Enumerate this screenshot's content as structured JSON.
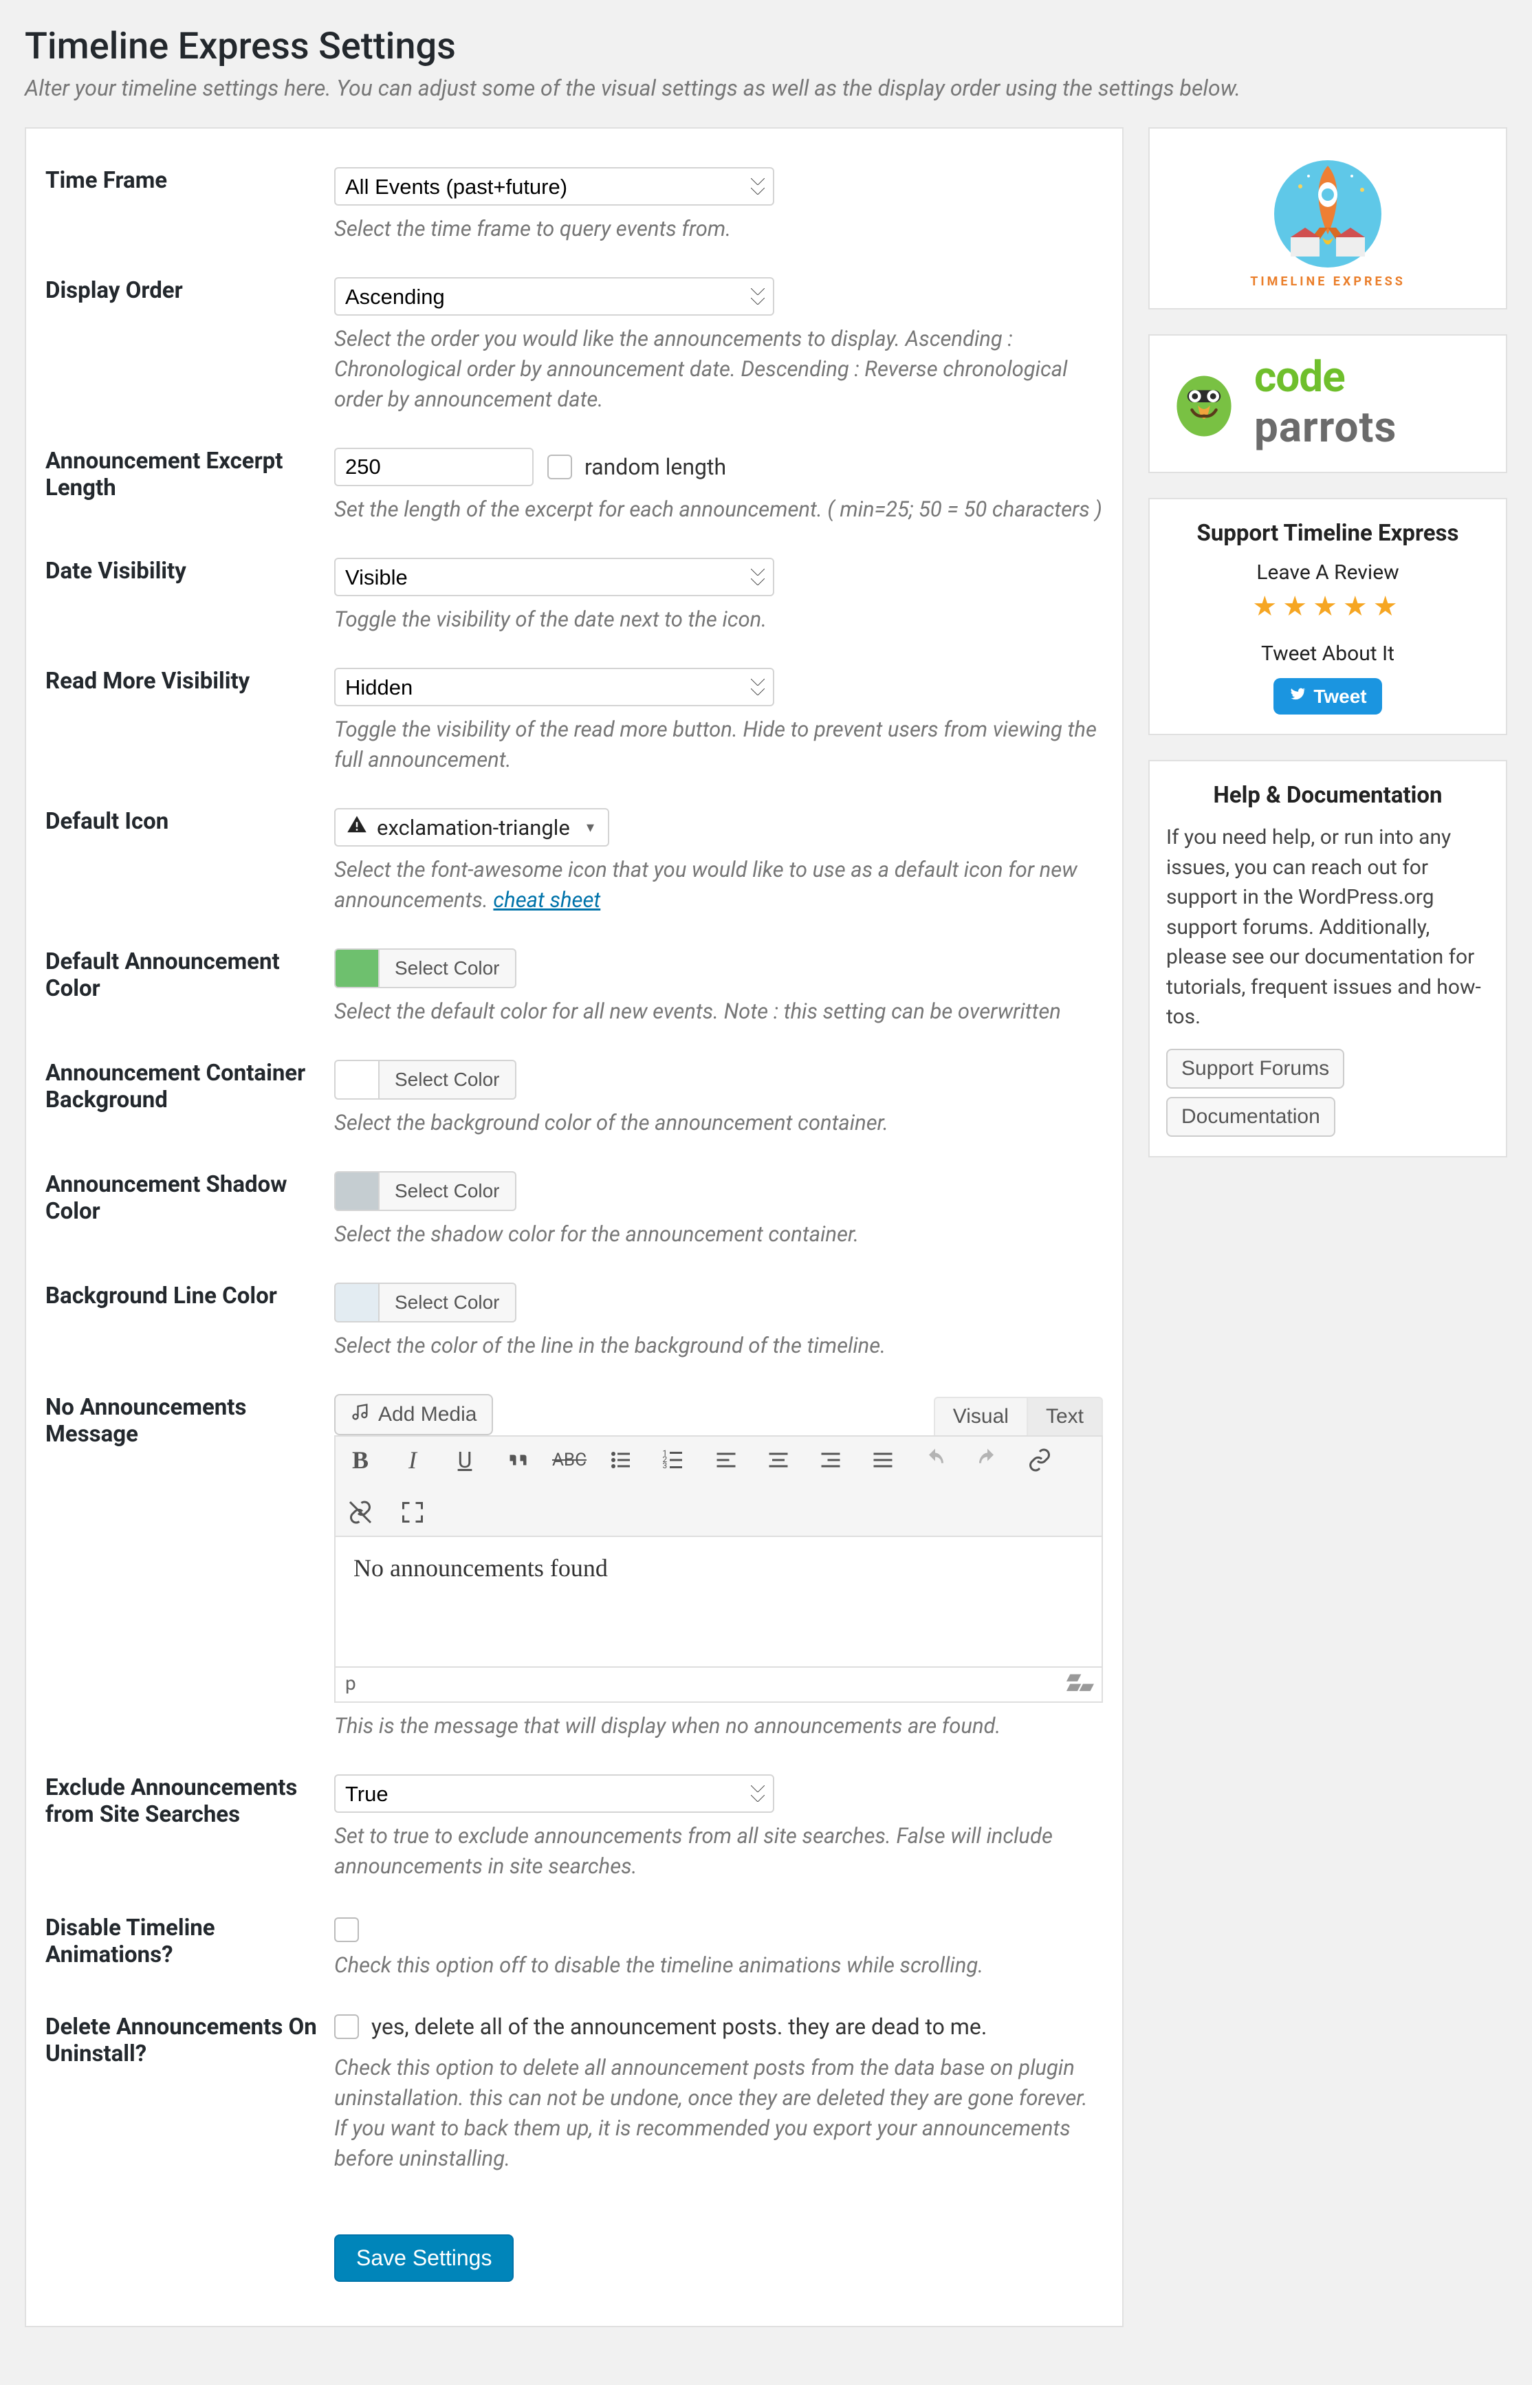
{
  "page": {
    "title": "Timeline Express Settings",
    "subtitle": "Alter your timeline settings here. You can adjust some of the visual settings as well as the display order using the settings below."
  },
  "form": {
    "time_frame": {
      "label": "Time Frame",
      "value": "All Events (past+future)",
      "desc": "Select the time frame to query events from."
    },
    "display_order": {
      "label": "Display Order",
      "value": "Ascending",
      "desc": "Select the order you would like the announcements to display. Ascending : Chronological order by announcement date. Descending : Reverse chronological order by announcement date."
    },
    "excerpt_length": {
      "label": "Announcement Excerpt Length",
      "value": "250",
      "random_label": "random length",
      "desc": "Set the length of the excerpt for each announcement. ( min=25; 50 = 50 characters )"
    },
    "date_visibility": {
      "label": "Date Visibility",
      "value": "Visible",
      "desc": "Toggle the visibility of the date next to the icon."
    },
    "read_more": {
      "label": "Read More Visibility",
      "value": "Hidden",
      "desc": "Toggle the visibility of the read more button. Hide to prevent users from viewing the full announcement."
    },
    "default_icon": {
      "label": "Default Icon",
      "value": "exclamation-triangle",
      "desc_prefix": "Select the font-awesome icon that you would like to use as a default icon for new announcements. ",
      "cheat_sheet": "cheat sheet"
    },
    "default_color": {
      "label": "Default Announcement Color",
      "btn": "Select Color",
      "swatch": "#6ec06e",
      "desc": "Select the default color for all new events. Note : this setting can be overwritten"
    },
    "container_bg": {
      "label": "Announcement Container Background",
      "btn": "Select Color",
      "swatch": "#ffffff",
      "desc": "Select the background color of the announcement container."
    },
    "shadow_color": {
      "label": "Announcement Shadow Color",
      "btn": "Select Color",
      "swatch": "#c5cdd1",
      "desc": "Select the shadow color for the announcement container."
    },
    "line_color": {
      "label": "Background Line Color",
      "btn": "Select Color",
      "swatch": "#e3ecf2",
      "desc": "Select the color of the line in the background of the timeline."
    },
    "no_announcements": {
      "label": "No Announcements Message",
      "add_media": "Add Media",
      "tab_visual": "Visual",
      "tab_text": "Text",
      "body": "No announcements found",
      "status_path": "p",
      "desc": "This is the message that will display when no announcements are found."
    },
    "exclude_search": {
      "label": "Exclude Announcements from Site Searches",
      "value": "True",
      "desc": "Set to true to exclude announcements from all site searches. False will include announcements in site searches."
    },
    "disable_anim": {
      "label": "Disable Timeline Animations?",
      "desc": "Check this option off to disable the timeline animations while scrolling."
    },
    "delete_uninstall": {
      "label": "Delete Announcements On Uninstall?",
      "cb_label": "yes, delete all of the announcement posts. they are dead to me.",
      "desc": "Check this option to delete all announcement posts from the data base on plugin uninstallation. this can not be undone, once they are deleted they are gone forever. If you want to back them up, it is recommended you export your announcements before uninstalling."
    },
    "save_btn": "Save Settings"
  },
  "sidebar": {
    "te_caption": "Timeline Express",
    "cp_code": "code",
    "cp_parrots": "parrots",
    "support": {
      "title": "Support Timeline Express",
      "review": "Leave A Review",
      "tweet_about": "Tweet About It",
      "tweet_btn": "Tweet"
    },
    "help": {
      "title": "Help & Documentation",
      "body": "If you need help, or run into any issues, you can reach out for support in the WordPress.org support forums. Additionally, please see our documentation for tutorials, frequent issues and how-tos.",
      "btn_forums": "Support Forums",
      "btn_docs": "Documentation"
    }
  }
}
